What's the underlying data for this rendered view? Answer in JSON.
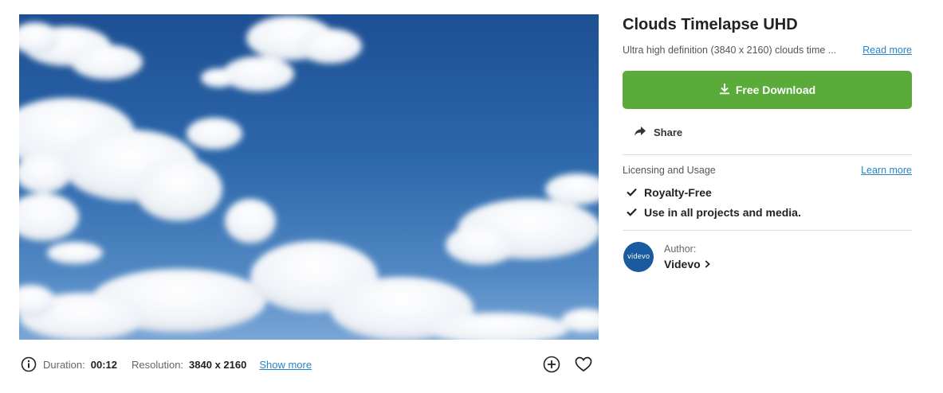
{
  "video": {
    "title": "Clouds Timelapse UHD",
    "description": "Ultra high definition (3840 x 2160) clouds time ...",
    "read_more": "Read more"
  },
  "meta": {
    "duration_label": "Duration:",
    "duration_value": "00:12",
    "resolution_label": "Resolution:",
    "resolution_value": "3840 x 2160",
    "show_more": "Show more"
  },
  "actions": {
    "download_label": "Free Download",
    "share_label": "Share"
  },
  "licensing": {
    "title": "Licensing and Usage",
    "learn_more": "Learn more",
    "features": [
      "Royalty-Free",
      "Use in all projects and media."
    ]
  },
  "author": {
    "label": "Author:",
    "name": "Videvo",
    "avatar_text": "videvo"
  },
  "colors": {
    "download_green": "#5aab3a",
    "link_blue": "#2a83c6",
    "avatar_blue": "#1a5a9e"
  },
  "icons": [
    "info-icon",
    "add-to-collection-icon",
    "heart-icon",
    "download-icon",
    "share-arrow-icon",
    "checkmark-icon",
    "chevron-right-icon"
  ]
}
